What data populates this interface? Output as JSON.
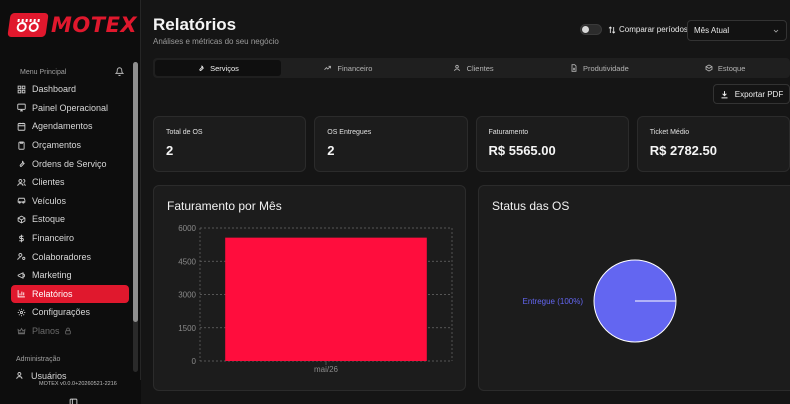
{
  "brand": {
    "name": "MOTEX",
    "version": "MOTEX v0.0.0+20260521-2216"
  },
  "sidebar": {
    "menu_header": "Menu Principal",
    "items": [
      {
        "label": "Dashboard",
        "icon": "layout-grid-icon"
      },
      {
        "label": "Painel Operacional",
        "icon": "monitor-icon"
      },
      {
        "label": "Agendamentos",
        "icon": "calendar-icon"
      },
      {
        "label": "Orçamentos",
        "icon": "clipboard-icon"
      },
      {
        "label": "Ordens de Serviço",
        "icon": "wrench-icon"
      },
      {
        "label": "Clientes",
        "icon": "users-icon"
      },
      {
        "label": "Veículos",
        "icon": "car-icon"
      },
      {
        "label": "Estoque",
        "icon": "package-icon"
      },
      {
        "label": "Financeiro",
        "icon": "dollar-icon"
      },
      {
        "label": "Colaboradores",
        "icon": "user-cog-icon"
      },
      {
        "label": "Marketing",
        "icon": "megaphone-icon"
      },
      {
        "label": "Relatórios",
        "icon": "bar-chart-icon",
        "active": true
      },
      {
        "label": "Configurações",
        "icon": "gear-icon"
      },
      {
        "label": "Planos",
        "icon": "crown-icon",
        "disabled": true
      }
    ],
    "admin_header": "Administração",
    "admin_partial": "Usuários"
  },
  "header": {
    "title": "Relatórios",
    "subtitle": "Análises e métricas do seu negócio",
    "compare_label": "Comparar períodos",
    "period_value": "Mês Atual"
  },
  "tabs": [
    {
      "label": "Serviços",
      "active": true
    },
    {
      "label": "Financeiro"
    },
    {
      "label": "Clientes"
    },
    {
      "label": "Produtividade"
    },
    {
      "label": "Estoque"
    }
  ],
  "export_label": "Exportar PDF",
  "cards": [
    {
      "label": "Total de OS",
      "value": "2"
    },
    {
      "label": "OS Entregues",
      "value": "2"
    },
    {
      "label": "Faturamento",
      "value": "R$ 5565.00"
    },
    {
      "label": "Ticket Médio",
      "value": "R$ 2782.50"
    }
  ],
  "colors": {
    "accent": "#e0182d",
    "bar": "#ff0d3d",
    "pie": "#6366f1"
  },
  "chart_data": [
    {
      "type": "bar",
      "title": "Faturamento por Mês",
      "categories": [
        "mai/26"
      ],
      "values": [
        5565
      ],
      "yticks": [
        0,
        1500,
        3000,
        4500,
        6000
      ],
      "ylim": [
        0,
        6000
      ],
      "grid": true
    },
    {
      "type": "pie",
      "title": "Status das OS",
      "labels": [
        "Entregue (100%)"
      ],
      "values": [
        100
      ]
    }
  ]
}
